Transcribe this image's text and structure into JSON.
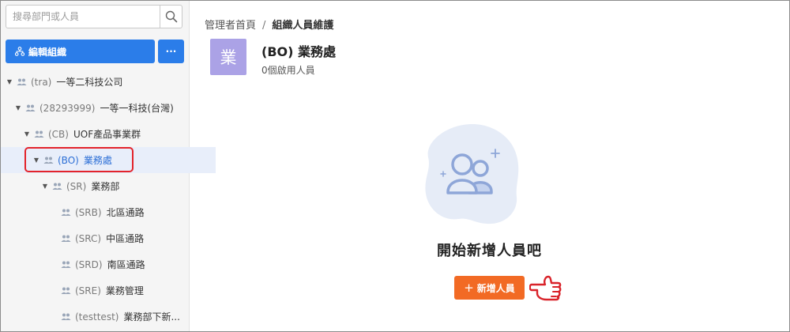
{
  "sidebar": {
    "search": {
      "placeholder": "搜尋部門或人員",
      "value": ""
    },
    "edit_button_label": "編輯組織",
    "more_button_label": "···",
    "tree": [
      {
        "code": "(tra)",
        "name": "一等二科技公司"
      },
      {
        "code": "(28293999)",
        "name": "一等一科技(台灣)"
      },
      {
        "code": "(CB)",
        "name": "UOF產品事業群"
      },
      {
        "code": "(BO)",
        "name": "業務處"
      },
      {
        "code": "(SR)",
        "name": "業務部"
      },
      {
        "code": "(SRB)",
        "name": "北區通路"
      },
      {
        "code": "(SRC)",
        "name": "中區通路"
      },
      {
        "code": "(SRD)",
        "name": "南區通路"
      },
      {
        "code": "(SRE)",
        "name": "業務管理"
      },
      {
        "code": "(testtest)",
        "name": "業務部下新..."
      }
    ]
  },
  "breadcrumb": {
    "home": "管理者首頁",
    "separator": "/",
    "current": "組織人員維護"
  },
  "department": {
    "avatar_char": "業",
    "title": "(BO) 業務處",
    "member_count": "0個啟用人員"
  },
  "empty_state": {
    "title": "開始新增人員吧",
    "add_button_label": "新增人員",
    "add_button_icon": "+"
  },
  "colors": {
    "primary": "#2b7de9",
    "accent": "#f26a24",
    "avatar": "#aba2e6",
    "highlight": "#e3232b"
  }
}
